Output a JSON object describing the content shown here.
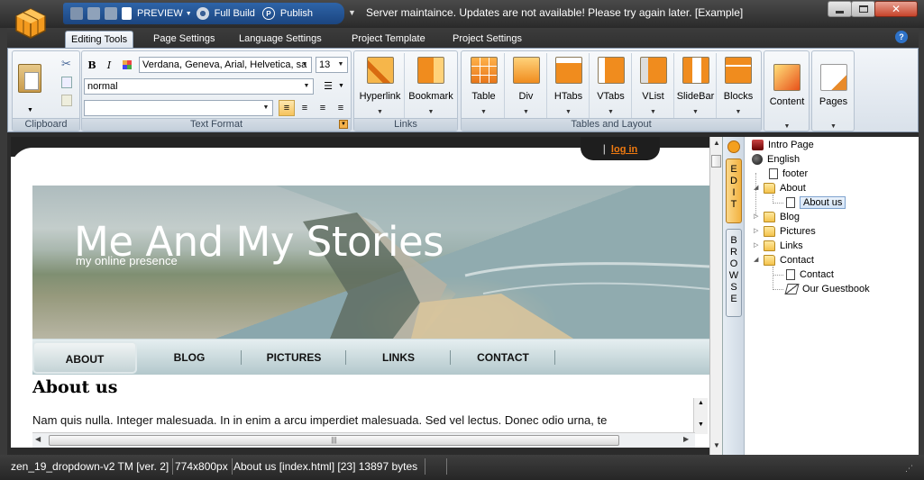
{
  "quickbar": {
    "preview_label": "PREVIEW",
    "full_build_label": "Full Build",
    "publish_label": "Publish",
    "publish_icon_letter": "P"
  },
  "window": {
    "title": "Server maintaince. Updates are not available! Please try again later. [Example]",
    "close_symbol": "✕"
  },
  "tabs": [
    {
      "label": "Editing Tools",
      "active": true
    },
    {
      "label": "Page Settings",
      "active": false
    },
    {
      "label": "Language Settings",
      "active": false
    },
    {
      "label": "Project Template",
      "active": false
    },
    {
      "label": "Project Settings",
      "active": false
    }
  ],
  "help_icon_glyph": "?",
  "ribbon": {
    "groups": {
      "clipboard": "Clipboard",
      "text_format": "Text Format",
      "links": "Links",
      "tables_layout": "Tables and Layout"
    },
    "bold_label": "B",
    "italic_label": "I",
    "font_family": "Verdana, Geneva, Arial, Helvetica, sa",
    "font_size": "13",
    "paragraph_style": "normal",
    "style_field": "",
    "links_buttons": [
      "Hyperlink",
      "Bookmark"
    ],
    "layout_buttons": [
      "Table",
      "Div",
      "HTabs",
      "VTabs",
      "VList",
      "SlideBar",
      "Blocks"
    ],
    "content_label": "Content",
    "pages_label": "Pages"
  },
  "site": {
    "login_separator": "|",
    "login_label": "log in",
    "title": "Me And My Stories",
    "subtitle": "my online presence",
    "nav": [
      "ABOUT",
      "BLOG",
      "PICTURES",
      "LINKS",
      "CONTACT"
    ],
    "active_nav": "ABOUT",
    "heading": "About us",
    "body": "Nam quis nulla. Integer malesuada. In in enim a arcu imperdiet malesuada. Sed vel lectus. Donec odio urna, te"
  },
  "side_panel": {
    "edit_tab": "EDIT",
    "browse_tab": "BROWSE",
    "tree": [
      {
        "label": "Intro Page",
        "icon": "intro-icon"
      },
      {
        "label": "English",
        "icon": "globe-icon"
      },
      {
        "label": "footer",
        "icon": "document-icon"
      },
      {
        "label": "About",
        "icon": "folder-icon",
        "expanded": true
      },
      {
        "label": "About us",
        "icon": "document-icon",
        "selected": true
      },
      {
        "label": "Blog",
        "icon": "folder-icon",
        "expanded": false
      },
      {
        "label": "Pictures",
        "icon": "folder-icon",
        "expanded": false
      },
      {
        "label": "Links",
        "icon": "folder-icon",
        "expanded": false
      },
      {
        "label": "Contact",
        "icon": "folder-icon",
        "expanded": true
      },
      {
        "label": "Contact",
        "icon": "document-icon"
      },
      {
        "label": "Our Guestbook",
        "icon": "guestbook-icon"
      }
    ]
  },
  "status": {
    "template": "zen_19_dropdown-v2 TM [ver. 2]",
    "size": "774x800px",
    "page": "About us [index.html] [23] 13897 bytes"
  }
}
